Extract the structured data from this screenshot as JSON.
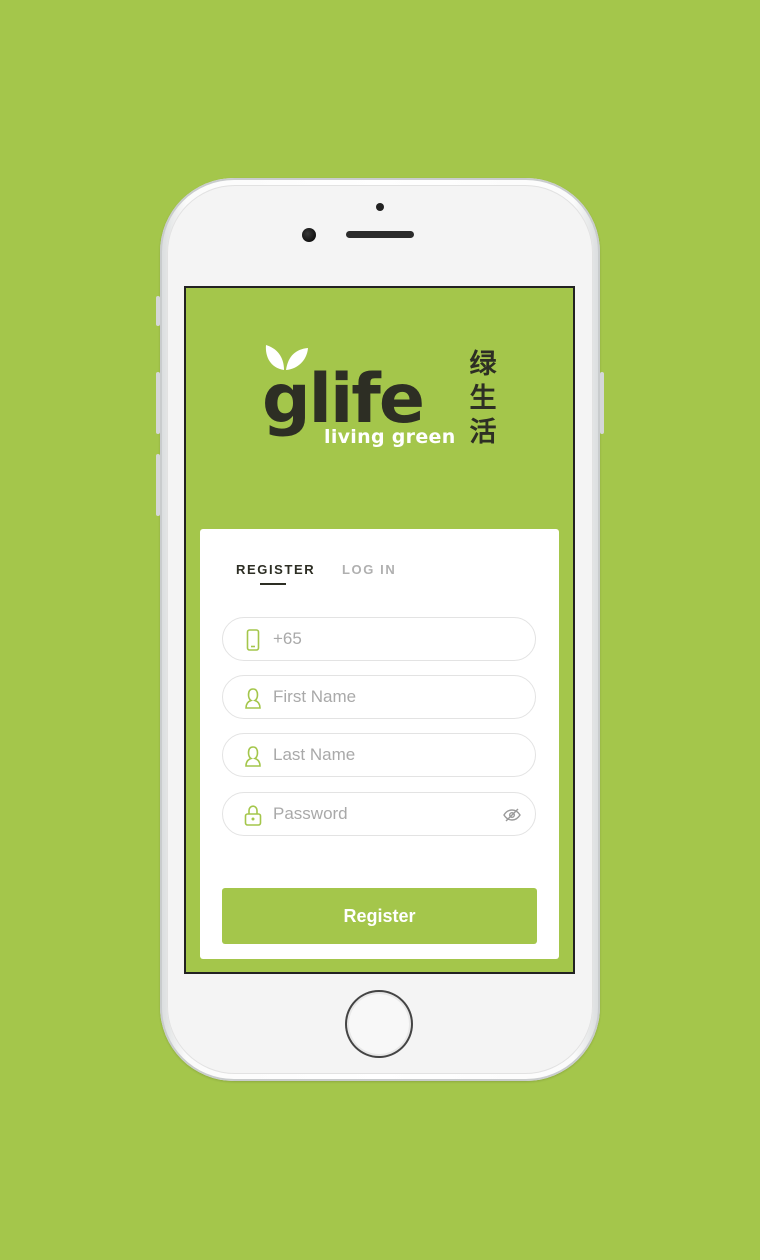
{
  "brand": {
    "logo_text": "glife",
    "tagline": "living green",
    "chinese_text": "绿生活",
    "accent_color": "#a4c64b",
    "dark_color": "#2d2e24"
  },
  "tabs": {
    "register_label": "REGISTER",
    "login_label": "LOG IN",
    "active": "register"
  },
  "form": {
    "phone": {
      "placeholder": "+65",
      "value": "",
      "icon": "phone-icon"
    },
    "first_name": {
      "placeholder": "First Name",
      "value": "",
      "icon": "user-icon"
    },
    "last_name": {
      "placeholder": "Last Name",
      "value": "",
      "icon": "user-icon"
    },
    "password": {
      "placeholder": "Password",
      "value": "",
      "icon": "lock-icon",
      "toggle_icon": "eye-off-icon"
    },
    "submit_label": "Register"
  }
}
